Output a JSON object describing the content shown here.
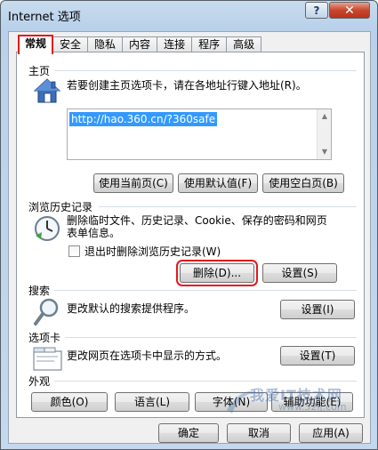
{
  "window": {
    "title": "Internet 选项",
    "help_label": "?",
    "close_label": "✕"
  },
  "tabs": [
    {
      "label": "常规",
      "active": true
    },
    {
      "label": "安全"
    },
    {
      "label": "隐私"
    },
    {
      "label": "内容"
    },
    {
      "label": "连接"
    },
    {
      "label": "程序"
    },
    {
      "label": "高级"
    }
  ],
  "homepage": {
    "label": "主页",
    "description": "若要创建主页选项卡，请在各地址行键入地址(R)。",
    "url": "http://hao.360.cn/?360safe",
    "use_current": "使用当前页(C)",
    "use_default": "使用默认值(F)",
    "use_blank": "使用空白页(B)"
  },
  "history": {
    "label": "浏览历史记录",
    "description_line1": "删除临时文件、历史记录、Cookie、保存的密码和网页",
    "description_line2": "表单信息。",
    "checkbox_label": "退出时删除浏览历史记录(W)",
    "delete_button": "删除(D)...",
    "settings_button": "设置(S)"
  },
  "search": {
    "label": "搜索",
    "description": "更改默认的搜索提供程序。",
    "settings_button": "设置(I)"
  },
  "tabsection": {
    "label": "选项卡",
    "description": "更改网页在选项卡中显示的方式。",
    "settings_button": "设置(T)"
  },
  "appearance": {
    "label": "外观",
    "colors": "颜色(O)",
    "languages": "语言(L)",
    "fonts": "字体(N)",
    "accessibility": "辅助功能(E)"
  },
  "footer": {
    "ok": "确定",
    "cancel": "取消",
    "apply": "应用(A)"
  },
  "watermark": {
    "text": "我爱IT技术网",
    "url": "www.52ij.com"
  },
  "icons": {
    "home": "home-icon",
    "history": "history-clock-icon",
    "search": "magnifier-icon",
    "tabs": "tabs-icon"
  },
  "colors": {
    "highlight_red": "#e2191e",
    "selection_blue": "#3399ff"
  }
}
